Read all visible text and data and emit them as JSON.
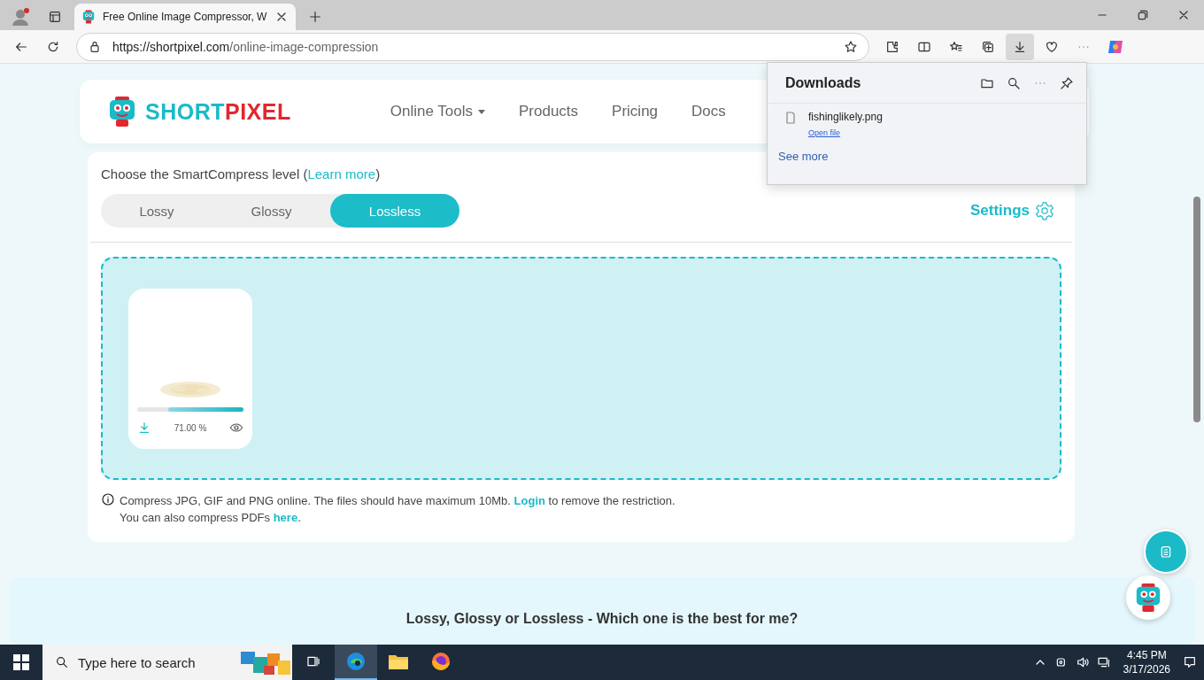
{
  "browser": {
    "tab": {
      "title": "Free Online Image Compressor, W"
    },
    "address": {
      "host": "https://shortpixel.com",
      "path": "/online-image-compression"
    }
  },
  "downloads": {
    "title": "Downloads",
    "items": [
      {
        "file": "fishinglikely.png",
        "action": "Open file"
      }
    ],
    "see_more": "See more"
  },
  "site": {
    "logo": {
      "part_1": "SHORT",
      "part_2": "PIXEL"
    },
    "nav": [
      {
        "label": "Online Tools",
        "dropdown": true
      },
      {
        "label": "Products",
        "dropdown": false
      },
      {
        "label": "Pricing",
        "dropdown": false
      },
      {
        "label": "Docs",
        "dropdown": false
      }
    ]
  },
  "compress": {
    "prompt": "Choose the SmartCompress level (",
    "link": "Learn more",
    "prompt_end": ")",
    "levels": [
      {
        "label": "Lossy",
        "selected": false
      },
      {
        "label": "Glossy",
        "selected": false
      },
      {
        "label": "Lossless",
        "selected": true
      }
    ],
    "settings": "Settings",
    "files": [
      {
        "level": 0.71,
        "percent": "71.00 %"
      }
    ],
    "note": {
      "text": "Compress JPG, GIF and PNG online. The files should have maximum 10Mb.",
      "link": "Login",
      "after": "to remove the restriction.",
      "line2": "You can also compress PDFs",
      "link2": "here",
      "end": "."
    }
  },
  "faq": {
    "heading": "Lossy, Glossy or Lossless - Which one is the best for me?"
  },
  "taskbar": {
    "search_placeholder": "Type here to search",
    "apps": [
      {
        "kind": "task-view",
        "selected": false
      },
      {
        "kind": "edge",
        "selected": true
      },
      {
        "kind": "explorer",
        "selected": false
      },
      {
        "kind": "firefox",
        "selected": false
      }
    ],
    "time": "4:45 PM",
    "date": "3/17/2026"
  }
}
